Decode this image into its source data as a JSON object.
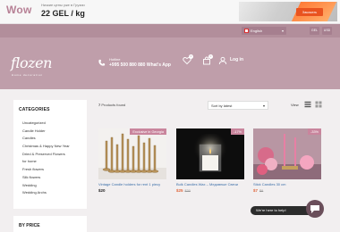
{
  "promo": {
    "brand": "Wow",
    "note": "Низкие цены уже в Грузии",
    "price": "22 GEL / kg",
    "button": "Заказать"
  },
  "header": {
    "language": "English",
    "currencies": [
      "GEL",
      "USD"
    ],
    "logo": "flozen",
    "logo_sub": "Home decoration",
    "hotline_label": "Hotline",
    "hotline_number": "+995 500 880 880 What's App",
    "wishlist_count": "0",
    "cart_count": "0",
    "login": "Log in"
  },
  "sidebar": {
    "title": "CATEGORIES",
    "items": [
      "Uncategorized",
      "Candle Holder",
      "Candles",
      "Christmas & Happy New Year",
      "Dried & Preserved Flowers",
      "for home",
      "Fresh flowers",
      "Silk flowers",
      "Wedding",
      "Wedding Archs"
    ],
    "price_title": "BY PRICE"
  },
  "toolbar": {
    "count": "7",
    "found_label": "Products found",
    "sort": "Sort by latest",
    "view_label": "View"
  },
  "products": [
    {
      "tag": "Exclusive in Georgia",
      "name": "Vintage Candle holders for rent 1 piecy",
      "price": "$20",
      "old_price": ""
    },
    {
      "tag": "-17%",
      "name": "Bulk Candles Wax – Медовные Свечи",
      "price": "$25",
      "old_price": "$30"
    },
    {
      "tag": "-33%",
      "name": "Stick Candles 30 cm",
      "price": "$7",
      "old_price": "$9"
    }
  ],
  "chat": {
    "label": "We're here to help!"
  },
  "colors": {
    "header": "#bf9eaa",
    "accent": "#c9859d",
    "promo": "#e9531f"
  }
}
